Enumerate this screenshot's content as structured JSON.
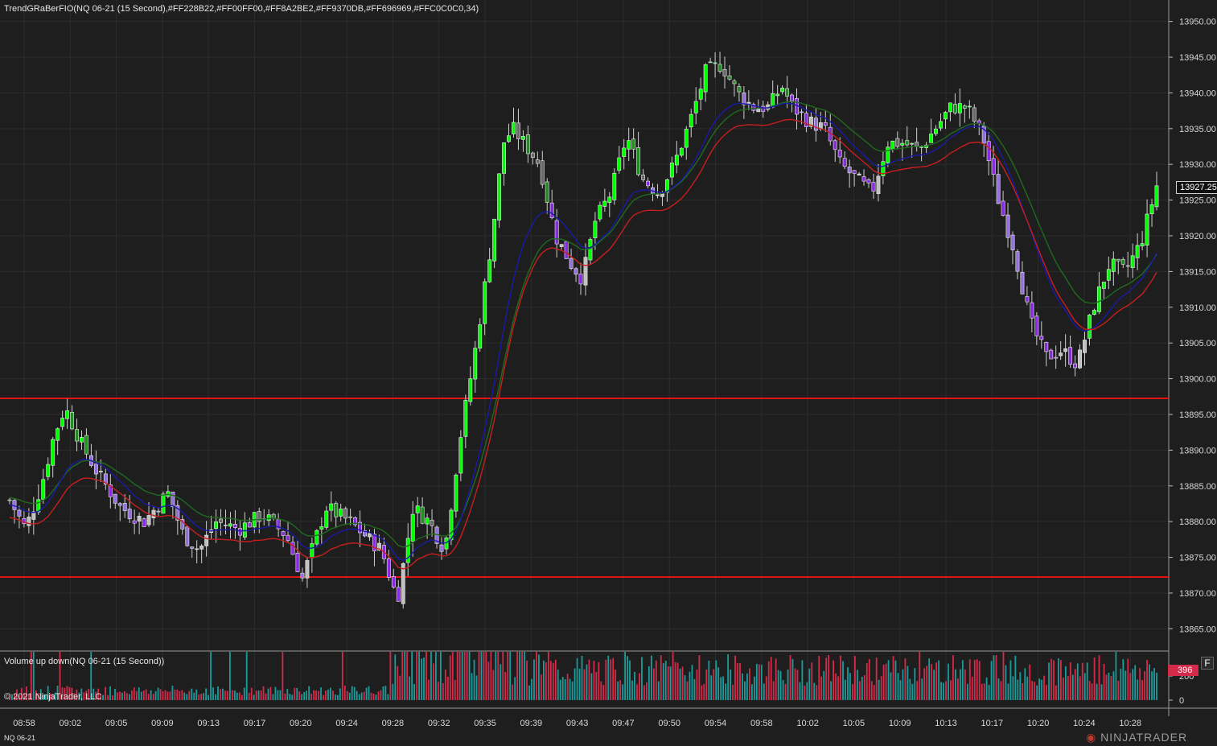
{
  "indicator_title": "TrendGRaBerFIO(NQ 06-21 (15 Second),#FF228B22,#FF00FF00,#FF8A2BE2,#FF9370DB,#FF696969,#FFC0C0C0,34)",
  "volume_title": "Volume up down(NQ 06-21 (15 Second))",
  "copyright": "© 2021 NinjaTrader, LLC",
  "instrument": "NQ 06-21",
  "logo_text": "NINJATRADER",
  "last_price_label": "13927.25",
  "last_volume_label": "396",
  "f_button_label": "F",
  "colors": {
    "background": "#1e1e1e",
    "grid": "#2c2c2c",
    "up_strong": "#00ff00",
    "up_weak": "#228b22",
    "down_strong": "#8a2be2",
    "down_weak": "#9370db",
    "neutral_dark": "#696969",
    "neutral_light": "#c0c0c0",
    "ma_fast": "#1a1aa8",
    "ma_mid": "#1f6b1f",
    "ma_slow": "#c81e1e",
    "level_line": "#e01414",
    "vol_up": "#1a9c9c",
    "vol_down": "#d52b4a"
  },
  "chart_data": [
    {
      "type": "candlestick",
      "title": "TrendGRaBerFIO(NQ 06-21 (15 Second),#FF228B22,#FF00FF00,#FF8A2BE2,#FF9370DB,#FF696969,#FFC0C0C0,34)",
      "x_ticks": [
        "08:58",
        "09:02",
        "09:05",
        "09:09",
        "09:13",
        "09:17",
        "09:20",
        "09:24",
        "09:28",
        "09:32",
        "09:35",
        "09:39",
        "09:43",
        "09:47",
        "09:50",
        "09:54",
        "09:58",
        "10:02",
        "10:05",
        "10:09",
        "10:13",
        "10:17",
        "10:20",
        "10:24",
        "10:28"
      ],
      "y_ticks": [
        "13950.00",
        "13945.00",
        "13940.00",
        "13935.00",
        "13930.00",
        "13925.00",
        "13920.00",
        "13915.00",
        "13910.00",
        "13905.00",
        "13900.00",
        "13895.00",
        "13890.00",
        "13885.00",
        "13880.00",
        "13875.00",
        "13870.00",
        "13865.00"
      ],
      "ylim": [
        13862,
        13953
      ],
      "last_price": 13927.25,
      "horizontal_levels": [
        13897.25,
        13872.25
      ],
      "close_path_key_points": [
        [
          0,
          13883
        ],
        [
          10,
          13879
        ],
        [
          20,
          13885
        ],
        [
          28,
          13892
        ],
        [
          35,
          13896
        ],
        [
          45,
          13891
        ],
        [
          55,
          13887
        ],
        [
          70,
          13882
        ],
        [
          85,
          13880
        ],
        [
          100,
          13884
        ],
        [
          110,
          13878
        ],
        [
          120,
          13876
        ],
        [
          130,
          13880
        ],
        [
          145,
          13879
        ],
        [
          160,
          13881
        ],
        [
          175,
          13878
        ],
        [
          185,
          13872
        ],
        [
          200,
          13882
        ],
        [
          215,
          13880
        ],
        [
          225,
          13878
        ],
        [
          235,
          13876
        ],
        [
          245,
          13869
        ],
        [
          255,
          13882
        ],
        [
          265,
          13880
        ],
        [
          275,
          13876
        ],
        [
          285,
          13892
        ],
        [
          295,
          13905
        ],
        [
          305,
          13920
        ],
        [
          312,
          13933
        ],
        [
          318,
          13935
        ],
        [
          325,
          13933
        ],
        [
          335,
          13930
        ],
        [
          345,
          13920
        ],
        [
          355,
          13916
        ],
        [
          362,
          13914
        ],
        [
          370,
          13922
        ],
        [
          380,
          13926
        ],
        [
          390,
          13934
        ],
        [
          400,
          13928
        ],
        [
          410,
          13926
        ],
        [
          420,
          13930
        ],
        [
          430,
          13936
        ],
        [
          440,
          13943
        ],
        [
          450,
          13944
        ],
        [
          460,
          13940
        ],
        [
          470,
          13938
        ],
        [
          480,
          13938
        ],
        [
          488,
          13941
        ],
        [
          495,
          13938
        ],
        [
          505,
          13936
        ],
        [
          515,
          13935
        ],
        [
          525,
          13930
        ],
        [
          535,
          13928
        ],
        [
          545,
          13926
        ],
        [
          555,
          13933
        ],
        [
          565,
          13933
        ],
        [
          575,
          13932
        ],
        [
          585,
          13935
        ],
        [
          595,
          13938
        ],
        [
          605,
          13938
        ],
        [
          615,
          13934
        ],
        [
          625,
          13925
        ],
        [
          635,
          13918
        ],
        [
          645,
          13908
        ],
        [
          655,
          13903
        ],
        [
          665,
          13904
        ],
        [
          675,
          13902
        ],
        [
          685,
          13910
        ],
        [
          695,
          13916
        ],
        [
          705,
          13915
        ],
        [
          715,
          13919
        ],
        [
          725,
          13927
        ]
      ],
      "horizontal_levels_note": ""
    },
    {
      "type": "bar",
      "title": "Volume up down(NQ 06-21 (15 Second))",
      "y_ticks": [
        "200",
        "0"
      ],
      "ylim": [
        0,
        400
      ],
      "last_value": 396,
      "series": [
        {
          "name": "",
          "color": "#1a9c9c"
        },
        {
          "name": "",
          "color": "#d52b4a"
        }
      ]
    }
  ]
}
